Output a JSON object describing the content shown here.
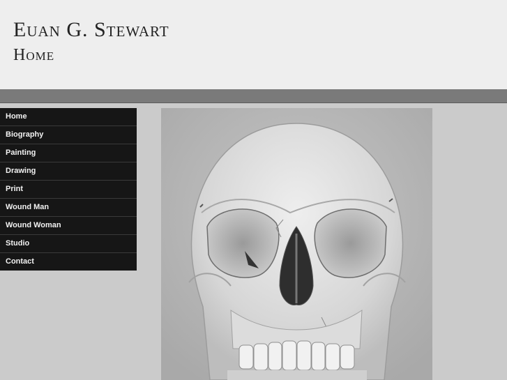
{
  "header": {
    "site_title": "Euan G. Stewart",
    "page_title": "Home"
  },
  "nav": {
    "items": [
      {
        "label": "Home"
      },
      {
        "label": "Biography"
      },
      {
        "label": "Painting"
      },
      {
        "label": "Drawing"
      },
      {
        "label": "Print"
      },
      {
        "label": "Wound Man"
      },
      {
        "label": "Wound Woman"
      },
      {
        "label": "Studio"
      },
      {
        "label": "Contact"
      }
    ]
  },
  "main": {
    "artwork_subject": "skull-drawing"
  },
  "colors": {
    "header_bg": "#eeeeee",
    "band": "#7a7a7a",
    "nav_bg": "#161616",
    "nav_text": "#f2f2f2",
    "page_bg": "#cbcbcb"
  }
}
